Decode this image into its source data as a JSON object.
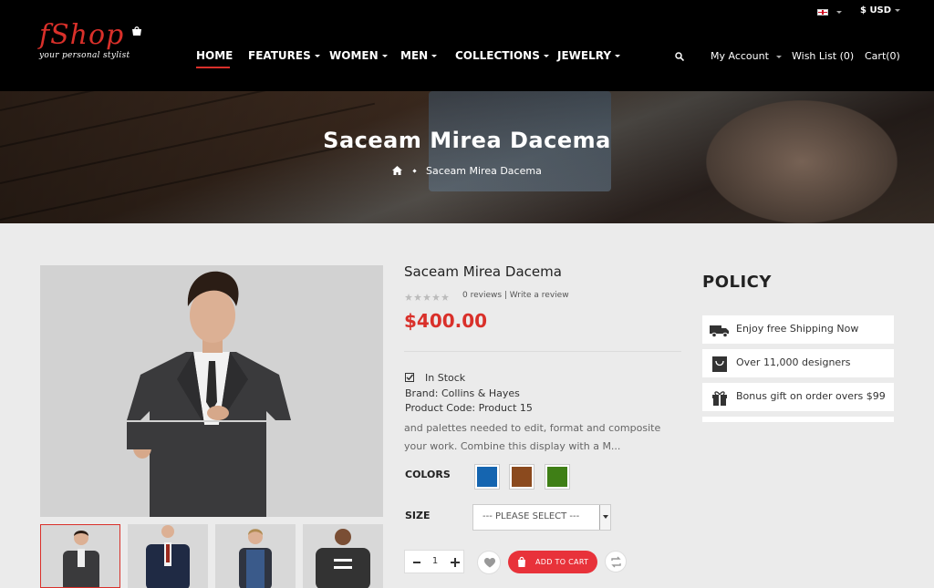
{
  "brand": {
    "name": "fShop",
    "tagline": "your personal stylist"
  },
  "topbar": {
    "currency": "$ USD"
  },
  "nav": {
    "items": [
      {
        "label": "HOME",
        "active": true,
        "dropdown": false
      },
      {
        "label": "FEATURES",
        "active": false,
        "dropdown": true
      },
      {
        "label": "WOMEN",
        "active": false,
        "dropdown": true
      },
      {
        "label": "MEN",
        "active": false,
        "dropdown": true
      },
      {
        "label": "COLLECTIONS",
        "active": false,
        "dropdown": true
      },
      {
        "label": "JEWELRY",
        "active": false,
        "dropdown": true
      }
    ],
    "account": "My Account",
    "wishlist": "Wish List (0)",
    "cart": "Cart(0)"
  },
  "banner": {
    "title": "Saceam Mirea Dacema",
    "breadcrumb": "Saceam Mirea Dacema"
  },
  "product": {
    "title": "Saceam Mirea Dacema",
    "rating": 0,
    "reviews_text": "0 reviews | Write a review",
    "price": "$400.00",
    "stock": "In Stock",
    "brand": "Brand:  Collins & Hayes",
    "code": "Product Code:  Product 15",
    "description": "and palettes needed to edit, format and composite your work. Combine this display with a M...",
    "colors_label": "COLORS",
    "colors": [
      "#1565b0",
      "#8b4a1e",
      "#3f7f16"
    ],
    "size_label": "SIZE",
    "size_placeholder": "--- PLEASE SELECT ---",
    "quantity": "1",
    "add_to_cart": "ADD TO CART"
  },
  "policy": {
    "title": "POLICY",
    "items": [
      {
        "icon": "truck-icon",
        "text": "Enjoy free Shipping Now"
      },
      {
        "icon": "bag-icon",
        "text": "Over 11,000 designers"
      },
      {
        "icon": "gift-icon",
        "text": "Bonus gift on order overs $99"
      }
    ]
  },
  "colors": {
    "accent": "#d9302a",
    "header": "#000000",
    "page": "#ebebeb"
  }
}
